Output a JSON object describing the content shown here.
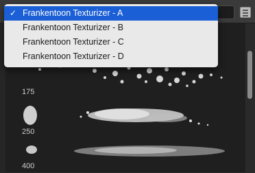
{
  "dropdown": {
    "items": [
      {
        "label": "Frankentoon Texturizer - A",
        "selected": true
      },
      {
        "label": "Frankentoon Texturizer - B",
        "selected": false
      },
      {
        "label": "Frankentoon Texturizer - C",
        "selected": false
      },
      {
        "label": "Frankentoon Texturizer - D",
        "selected": false
      }
    ],
    "check_mark": "✓"
  },
  "presets": {
    "sizes": [
      "175",
      "250",
      "400"
    ]
  },
  "colors": {
    "selection": "#1b5fd6",
    "menu_bg": "#e9e9e9",
    "panel_bg": "#1f1f1f"
  },
  "icons": [
    "menu-icon"
  ]
}
